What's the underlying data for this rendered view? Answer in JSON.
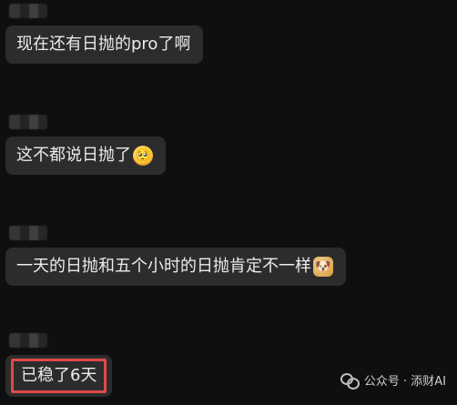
{
  "messages": [
    {
      "text": "现在还有日抛的pro了啊",
      "emoji": "",
      "emoji_name": ""
    },
    {
      "text": "这不都说日抛了",
      "emoji": "🥺",
      "emoji_name": "worried-face-icon"
    },
    {
      "text": "一天的日抛和五个小时的日抛肯定不一样",
      "emoji": "🐶",
      "emoji_name": "doge-icon"
    },
    {
      "text": "已稳了6天",
      "emoji": "",
      "emoji_name": "",
      "highlighted": true,
      "highlight_color": "#e04848"
    }
  ],
  "watermark": {
    "label": "公众号 · 添财AI",
    "icon": "wechat-icon"
  },
  "colors": {
    "background": "#0f0f0f",
    "bubble": "#2c2c2c",
    "text": "#ebebeb"
  }
}
